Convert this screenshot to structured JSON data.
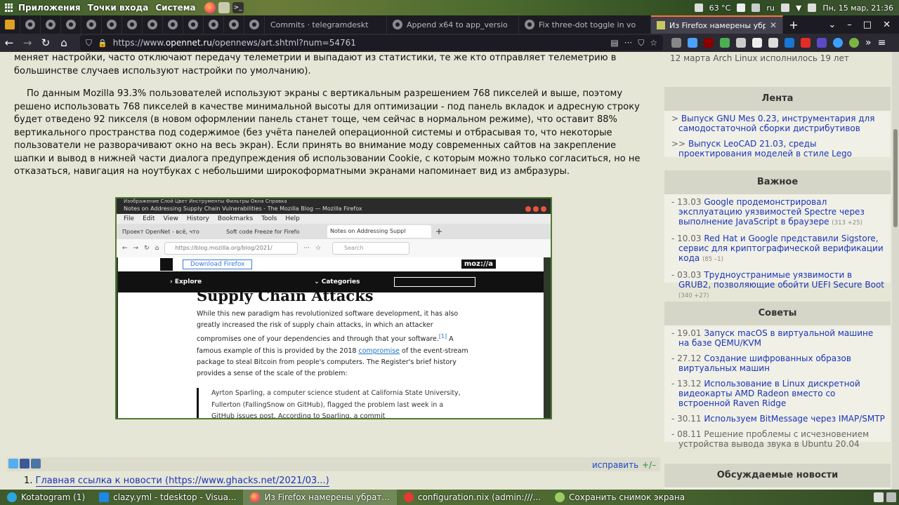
{
  "system_panel": {
    "menus": [
      "Приложения",
      "Точки входа",
      "Система"
    ],
    "temperature": "63 °C",
    "keyboard_layout": "ru",
    "datetime": "Пн, 15 мар, 21:36"
  },
  "tabs": [
    {
      "label": "Commits · telegramdeskt",
      "icon": "github-icon"
    },
    {
      "label": "Append x64 to app_versio",
      "icon": "github-icon"
    },
    {
      "label": "Fix three-dot toggle in vo",
      "icon": "github-icon"
    },
    {
      "label": "Из Firefox намерены убр",
      "icon": "opennet-icon",
      "active": true
    }
  ],
  "navbar": {
    "url_prefix": "https://www.",
    "url_domain": "opennet.ru",
    "url_rest": "/opennews/art.shtml?num=54761"
  },
  "article": {
    "para1": "меняет настройки, часто отключают передачу телеметрии и выпадают из статистики, те же кто отправляет телеметрию в большинстве случаев используют настройки по умолчанию).",
    "para2": "По данным Mozilla 93.3% пользователей используют экраны с вертикальным разрешением 768 пикселей и выше, поэтому решено использовать 768 пикселей в качестве минимальной высоты для оптимизации - под панель вкладок и адресную строку будет отведено 92 пикселя (в новом оформлении панель станет тоще, чем сейчас в нормальном режиме), что оставит 88% вертикального пространства под содержимое (без учёта панелей операционной системы и отбрасывая то, что некоторые пользователи не разворачивают окно на весь экран). Если принять во внимание моду современных сайтов на закрепление шапки и вывод в нижней части диалога предупреждения об использовании Cookie, с которым можно только согласиться, но не отказаться, навигация на ноутбуках с небольшими широкоформатными экранами напоминает вид из амбразуры.",
    "fix_label": "исправить",
    "fix_pm": "+/–",
    "link_prefix": "1. ",
    "link_text": "Главная ссылка к новости (https://www.ghacks.net/2021/03...)"
  },
  "embedded": {
    "gimp_menu": "Изображение  Слой  Цвет  Инструменты  Фильтры  Окна  Справка",
    "title": "Notes on Addressing Supply Chain Vulnerabilities - The Mozilla Blog — Mozilla Firefox",
    "menubar": [
      "File",
      "Edit",
      "View",
      "History",
      "Bookmarks",
      "Tools",
      "Help"
    ],
    "tabs": [
      "Проект OpenNet - всё, что",
      "Soft code Freeze for Firefo",
      "Notes on Addressing Suppl"
    ],
    "url": "https://blog.mozilla.org/blog/2021/",
    "search_placeholder": "Search",
    "download_btn": "Download Firefox",
    "logo": "moz://a",
    "nav_explore": "Explore",
    "nav_categories": "Categories",
    "heading": "Supply Chain Attacks",
    "para_a": "While this new paradigm has revolutionized software development, it has also greatly increased the risk of supply chain attacks, in which an attacker compromises one of your dependencies and through that your software.",
    "footnote": "[1]",
    "para_a2": " A famous example of this is provided by the 2018 ",
    "para_link": "compromise",
    "para_b": " of the event-stream package to steal Bitcoin from people's computers. The Register's brief history provides a sense of the scale of the problem:",
    "quote": "Ayrton Sparling, a computer science student at California State University, Fullerton (FallingSnow on GitHub), flagged the problem last week in a GitHub issues post. According to Sparling, a commit"
  },
  "sidebar": {
    "top_text": "12 марта Arch Linux исполнилось 19 лет",
    "feed": {
      "title": "Лента",
      "items": [
        {
          "bullet": ">",
          "text": "Выпуск GNU Mes 0.23, инструментария для самодостаточной сборки дистрибутивов"
        },
        {
          "bullet": ">>",
          "text": "Выпуск LeoCAD 21.03, среды проектирования моделей в стиле Lego"
        }
      ]
    },
    "important": {
      "title": "Важное",
      "items": [
        {
          "date": "- 13.03",
          "text": "Google продемонстрировал эксплуатацию уязвимостей Spectre через выполнение JavaScript в браузере",
          "count": "(313 +25)"
        },
        {
          "date": "- 10.03",
          "text": "Red Hat и Google представили Sigstore, сервис для криптографической верификации кода",
          "count": "(85 –1)"
        },
        {
          "date": "- 03.03",
          "text": "Трудноустранимые уязвимости в GRUB2, позволяющие обойти UEFI Secure Boot",
          "count": "(340 +27)"
        }
      ]
    },
    "tips": {
      "title": "Советы",
      "items": [
        {
          "date": "- 19.01",
          "text": "Запуск macOS в виртуальной машине на базе QEMU/KVM",
          "link": true
        },
        {
          "date": "- 27.12",
          "text": "Создание шифрованных образов виртуальных машин",
          "link": true
        },
        {
          "date": "- 13.12",
          "text": "Использование в Linux дискретной видеокарты AMD Radeon вместо со встроенной Raven Ridge",
          "link": true
        },
        {
          "date": "- 30.11",
          "text": "Используем BitMessage через IMAP/SMTP",
          "link": true
        },
        {
          "date": "- 08.11",
          "text": "Решение проблемы с исчезновением устройства вывода звука в Ubuntu 20.04",
          "link": false
        }
      ]
    },
    "discussed": {
      "title": "Обсуждаемые новости"
    }
  },
  "taskbar": [
    {
      "label": "Kotatogram (1)",
      "icon": "telegram-icon",
      "color": "#2ca5e0"
    },
    {
      "label": "clazy.yml - tdesktop - Visua...",
      "icon": "vscode-icon",
      "color": "#1e88e5"
    },
    {
      "label": "Из Firefox намерены убрат...",
      "icon": "firefox-icon",
      "color": "#ff7139",
      "active": true
    },
    {
      "label": "configuration.nix (admin:///...",
      "icon": "editor-icon",
      "color": "#e53935"
    },
    {
      "label": "Сохранить снимок экрана",
      "icon": "camera-icon",
      "color": "#9ccc65"
    }
  ]
}
